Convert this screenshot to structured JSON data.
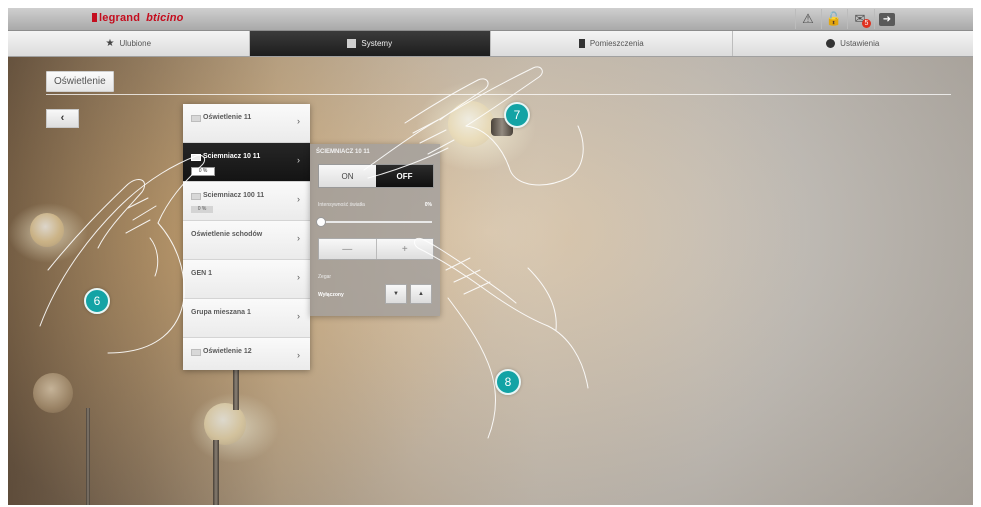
{
  "brand": {
    "part1": "legrand",
    "part2": "bticino"
  },
  "topbar": {
    "icons": [
      "warning-icon",
      "unlock-icon",
      "mail-icon",
      "exit-icon"
    ],
    "mail_badge": "5"
  },
  "tabs": [
    {
      "label": "Ulubione",
      "icon": "star-icon"
    },
    {
      "label": "Systemy",
      "icon": "systems-icon",
      "active": true
    },
    {
      "label": "Pomieszczenia",
      "icon": "door-icon"
    },
    {
      "label": "Ustawienia",
      "icon": "settings-icon"
    }
  ],
  "page": {
    "title": "Oświetlenie",
    "back_label": "‹"
  },
  "list": {
    "items": [
      {
        "label": "Oświetlenie 11",
        "chevron": "›"
      },
      {
        "label": "Sciemniacz 10 11",
        "value": "0 %",
        "chevron": "›",
        "selected": true
      },
      {
        "label": "Sciemniacz 100 11",
        "value": "0 %",
        "chevron": "›"
      },
      {
        "label": "Oświetlenie schodów",
        "chevron": "›"
      },
      {
        "label": "GEN 1",
        "chevron": "›"
      },
      {
        "label": "Grupa mieszana 1",
        "chevron": "›"
      },
      {
        "label": "Oświetlenie 12",
        "chevron": "›"
      }
    ]
  },
  "detail": {
    "title": "ŚCIEMNIACZ 10 11",
    "on_label": "ON",
    "off_label": "OFF",
    "intensity_label": "Intensywność światła",
    "intensity_value": "0%",
    "intensity_level": 0,
    "minus_label": "—",
    "plus_label": "+",
    "clock_label": "Zegar",
    "clock_value": "Wyłączony",
    "down_label": "▼",
    "up_label": "▲"
  },
  "callouts": {
    "six": "6",
    "seven": "7",
    "eight": "8"
  },
  "colors": {
    "accent": "#13a3a5",
    "brand_red": "#c40d1e",
    "active_tab": "#1d1d1d"
  }
}
